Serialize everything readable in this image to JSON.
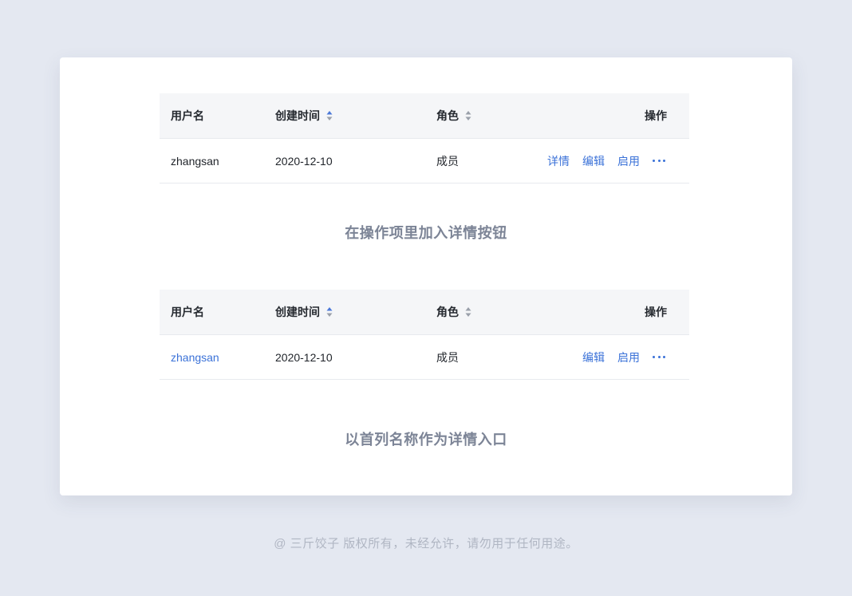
{
  "tables": [
    {
      "headers": {
        "user": "用户名",
        "time": "创建时间",
        "role": "角色",
        "ops": "操作"
      },
      "row": {
        "user": "zhangsan",
        "time": "2020-12-10",
        "role": "成员",
        "actions": [
          "详情",
          "编辑",
          "启用"
        ]
      },
      "caption": "在操作项里加入详情按钮"
    },
    {
      "headers": {
        "user": "用户名",
        "time": "创建时间",
        "role": "角色",
        "ops": "操作"
      },
      "row": {
        "user": "zhangsan",
        "time": "2020-12-10",
        "role": "成员",
        "actions": [
          "编辑",
          "启用"
        ]
      },
      "caption": "以首列名称作为详情入口"
    }
  ],
  "footer": "@ 三斤饺子  版权所有，未经允许，请勿用于任何用途。",
  "colors": {
    "link": "#3b72d8",
    "sort_active": "#4a78d8",
    "sort_inactive": "#9aa0aa"
  },
  "icons": {
    "sort": "sort-icon",
    "more": "more-dots-icon"
  }
}
